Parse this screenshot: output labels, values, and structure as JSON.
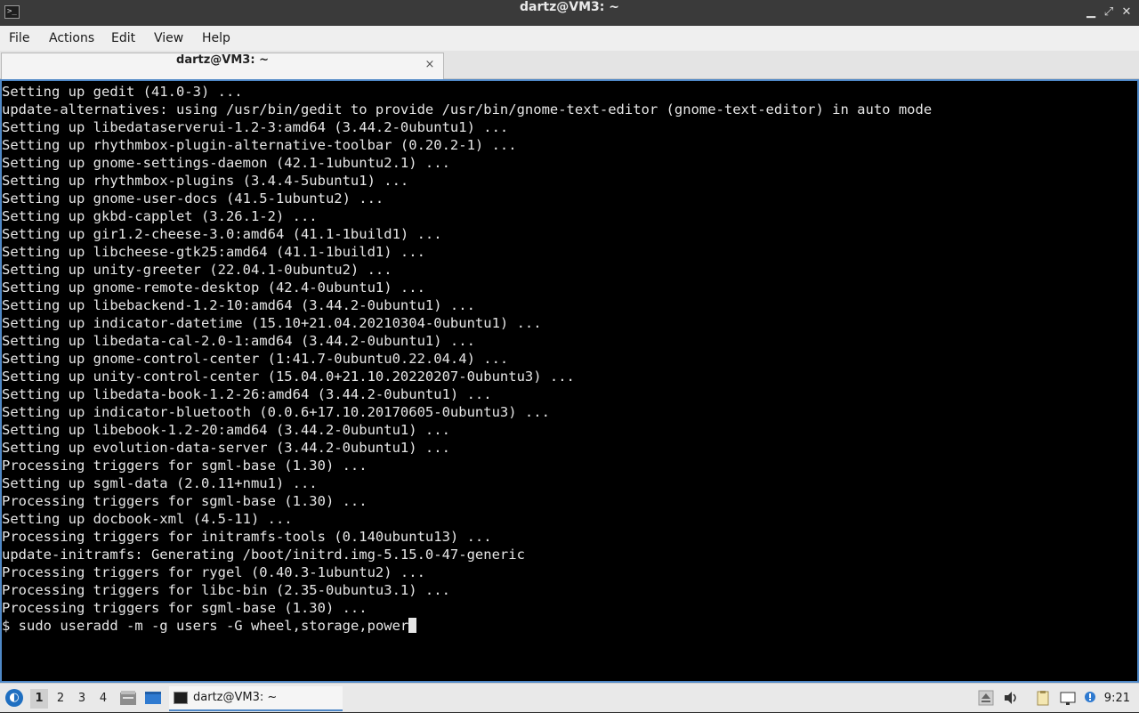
{
  "window": {
    "title": "dartz@VM3: ~",
    "controls": {
      "minimize": "▁",
      "maximize": "⤢",
      "close": "✕"
    }
  },
  "menu": {
    "items": [
      "File",
      "Actions",
      "Edit",
      "View",
      "Help"
    ]
  },
  "tabs": [
    {
      "label": "dartz@VM3: ~",
      "close": "×"
    }
  ],
  "terminal": {
    "lines": [
      "Setting up gedit (41.0-3) ...",
      "update-alternatives: using /usr/bin/gedit to provide /usr/bin/gnome-text-editor (gnome-text-editor) in auto mode",
      "Setting up libedataserverui-1.2-3:amd64 (3.44.2-0ubuntu1) ...",
      "Setting up rhythmbox-plugin-alternative-toolbar (0.20.2-1) ...",
      "Setting up gnome-settings-daemon (42.1-1ubuntu2.1) ...",
      "Setting up rhythmbox-plugins (3.4.4-5ubuntu1) ...",
      "Setting up gnome-user-docs (41.5-1ubuntu2) ...",
      "Setting up gkbd-capplet (3.26.1-2) ...",
      "Setting up gir1.2-cheese-3.0:amd64 (41.1-1build1) ...",
      "Setting up libcheese-gtk25:amd64 (41.1-1build1) ...",
      "Setting up unity-greeter (22.04.1-0ubuntu2) ...",
      "Setting up gnome-remote-desktop (42.4-0ubuntu1) ...",
      "Setting up libebackend-1.2-10:amd64 (3.44.2-0ubuntu1) ...",
      "Setting up indicator-datetime (15.10+21.04.20210304-0ubuntu1) ...",
      "Setting up libedata-cal-2.0-1:amd64 (3.44.2-0ubuntu1) ...",
      "Setting up gnome-control-center (1:41.7-0ubuntu0.22.04.4) ...",
      "Setting up unity-control-center (15.04.0+21.10.20220207-0ubuntu3) ...",
      "Setting up libedata-book-1.2-26:amd64 (3.44.2-0ubuntu1) ...",
      "Setting up indicator-bluetooth (0.0.6+17.10.20170605-0ubuntu3) ...",
      "Setting up libebook-1.2-20:amd64 (3.44.2-0ubuntu1) ...",
      "Setting up evolution-data-server (3.44.2-0ubuntu1) ...",
      "Processing triggers for sgml-base (1.30) ...",
      "Setting up sgml-data (2.0.11+nmu1) ...",
      "Processing triggers for sgml-base (1.30) ...",
      "Setting up docbook-xml (4.5-11) ...",
      "Processing triggers for initramfs-tools (0.140ubuntu13) ...",
      "update-initramfs: Generating /boot/initrd.img-5.15.0-47-generic",
      "Processing triggers for rygel (0.40.3-1ubuntu2) ...",
      "Processing triggers for libc-bin (2.35-0ubuntu3.1) ...",
      "Processing triggers for sgml-base (1.30) ..."
    ],
    "prompt": "$ ",
    "command": "sudo useradd -m -g users -G wheel,storage,power"
  },
  "taskbar": {
    "workspaces": [
      "1",
      "2",
      "3",
      "4"
    ],
    "active_workspace": "1",
    "task_label": "dartz@VM3: ~",
    "clock": "9:21"
  },
  "colors": {
    "terminal_bg": "#000000",
    "terminal_fg": "#e6e6e6",
    "accent": "#4f88c7"
  }
}
